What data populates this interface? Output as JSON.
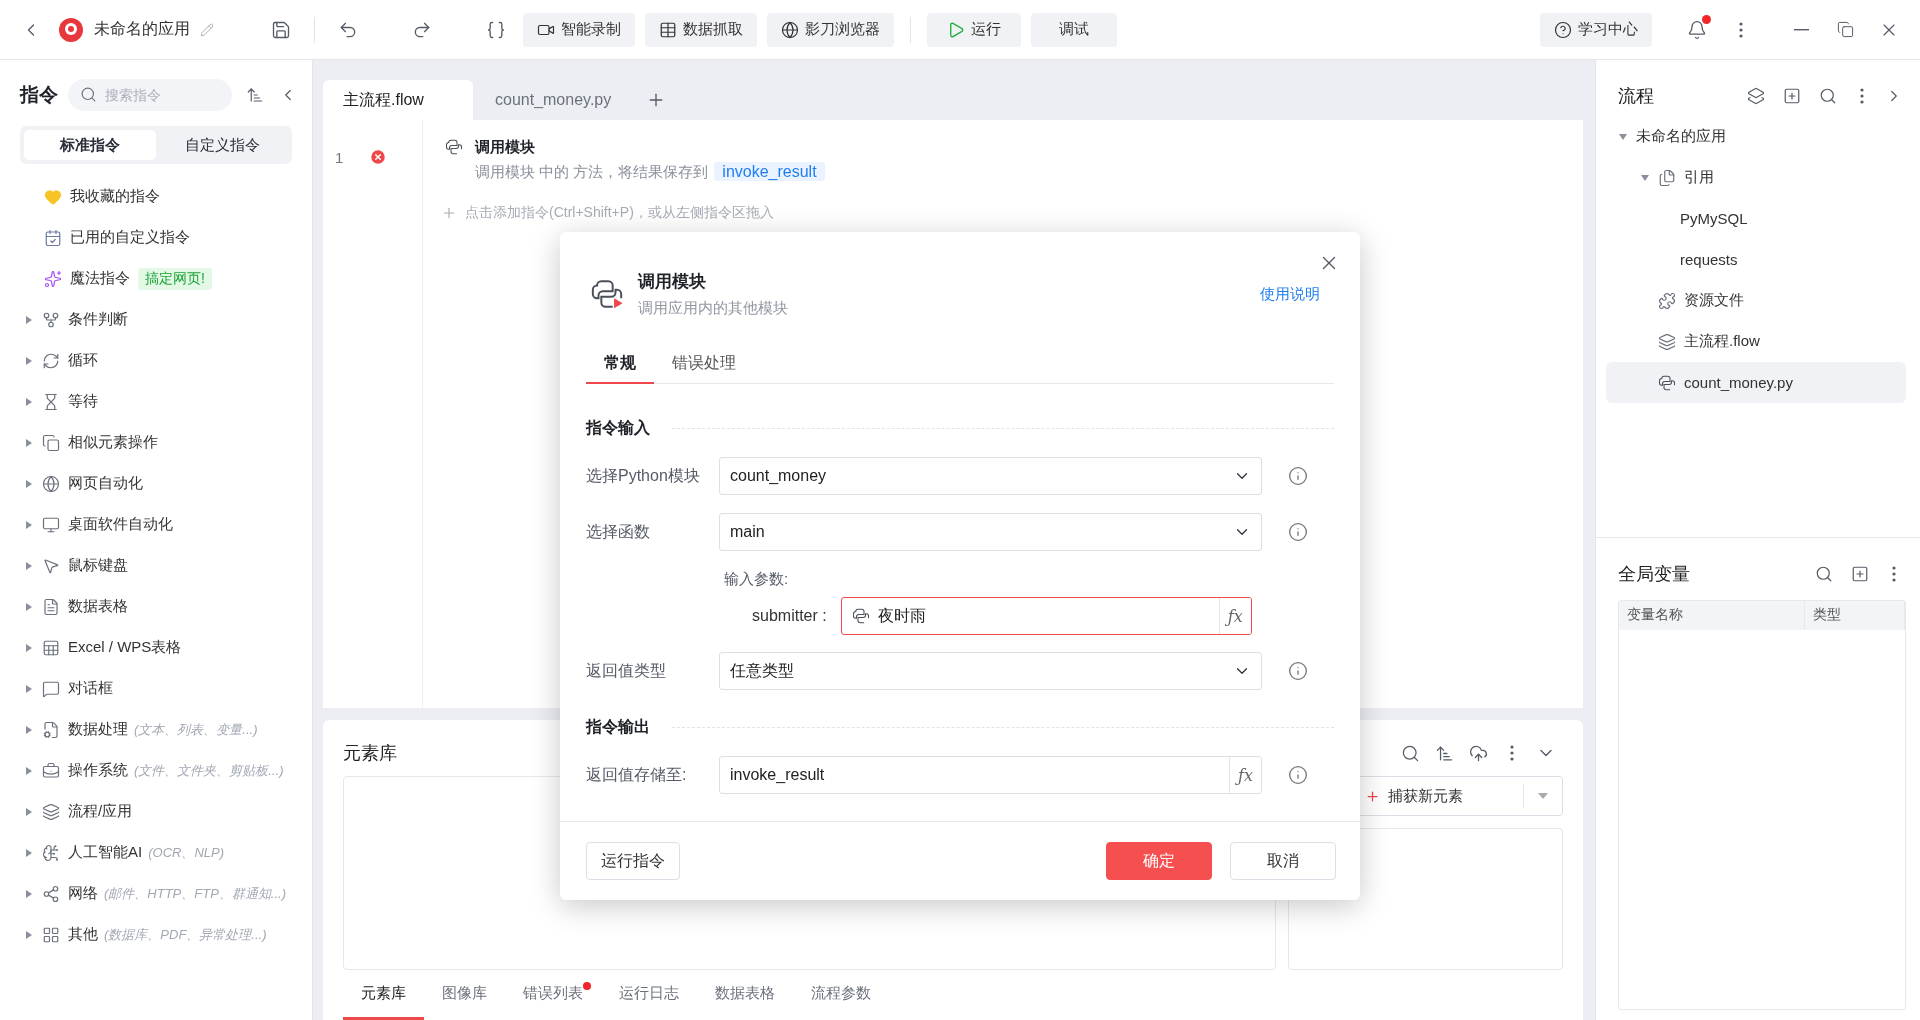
{
  "topbar": {
    "app_title": "未命名的应用",
    "tools": [
      {
        "label": "智能录制",
        "kind": "record"
      },
      {
        "label": "数据抓取",
        "kind": "grab"
      },
      {
        "label": "影刀浏览器",
        "kind": "browser"
      }
    ],
    "run": "运行",
    "debug": "调试",
    "learn": "学习中心",
    "notification": true
  },
  "sidebar": {
    "title": "指令",
    "search": {
      "placeholder": "搜索指令"
    },
    "tabs": [
      {
        "label": "标准指令",
        "selected": true
      },
      {
        "label": "自定义指令",
        "selected": false
      }
    ],
    "shortcuts": [
      {
        "label": "我收藏的指令",
        "kind": "favorite"
      },
      {
        "label": "已用的自定义指令",
        "kind": "custom"
      },
      {
        "label": "魔法指令",
        "kind": "magic",
        "badge": "搞定网页!"
      }
    ],
    "categories": [
      {
        "label": "条件判断",
        "expanded": false
      },
      {
        "label": "循环",
        "expanded": false
      },
      {
        "label": "等待",
        "expanded": false
      },
      {
        "label": "相似元素操作",
        "expanded": false
      },
      {
        "label": "网页自动化",
        "expanded": false
      },
      {
        "label": "桌面软件自动化",
        "expanded": false
      },
      {
        "label": "鼠标键盘",
        "expanded": false
      },
      {
        "label": "数据表格",
        "expanded": false
      },
      {
        "label": "Excel / WPS表格",
        "expanded": false
      },
      {
        "label": "对话框",
        "expanded": false
      },
      {
        "label": "数据处理",
        "hint": "(文本、列表、变量...)",
        "expanded": false
      },
      {
        "label": "操作系统",
        "hint": "(文件、文件夹、剪贴板...)",
        "expanded": false
      },
      {
        "label": "流程/应用",
        "expanded": false
      },
      {
        "label": "人工智能AI",
        "hint": "(OCR、NLP)",
        "expanded": false
      },
      {
        "label": "网络",
        "hint": "(邮件、HTTP、FTP、群通知...)",
        "expanded": false
      },
      {
        "label": "其他",
        "hint": "(数据库、PDF、异常处理...)",
        "expanded": false
      }
    ]
  },
  "editor": {
    "tabs": [
      {
        "label": "主流程.flow",
        "selected": true
      },
      {
        "label": "count_money.py",
        "selected": false
      }
    ],
    "lines": [
      {
        "number": "1",
        "error": true,
        "title": "调用模块",
        "description": "调用模块 中的 方法，将结果保存到",
        "variable": "invoke_result"
      }
    ],
    "add_hint": "点击添加指令(Ctrl+Shift+P)，或从左侧指令区拖入"
  },
  "element_panel": {
    "title": "元素库",
    "capture_button": "捕获新元素",
    "tabs": [
      {
        "label": "元素库",
        "selected": true,
        "alert": false
      },
      {
        "label": "图像库",
        "selected": false,
        "alert": false
      },
      {
        "label": "错误列表",
        "selected": false,
        "alert": true
      },
      {
        "label": "运行日志",
        "selected": false,
        "alert": false
      },
      {
        "label": "数据表格",
        "selected": false,
        "alert": false
      },
      {
        "label": "流程参数",
        "selected": false,
        "alert": false
      }
    ]
  },
  "dialog": {
    "title": "调用模块",
    "subtitle": "调用应用内的其他模块",
    "help_link": "使用说明",
    "tabs": [
      {
        "label": "常规",
        "selected": true
      },
      {
        "label": "错误处理",
        "selected": false
      }
    ],
    "sections": [
      {
        "title": "指令输入",
        "fields": [
          {
            "kind": "select",
            "label": "选择Python模块",
            "value": "count_money"
          },
          {
            "kind": "select",
            "label": "选择函数",
            "value": "main"
          },
          {
            "kind": "params",
            "label": "输入参数:",
            "params": [
              {
                "name": "submitter :",
                "value": "夜时雨",
                "error": true,
                "fx": "ƒx"
              }
            ]
          },
          {
            "kind": "select",
            "label": "返回值类型",
            "value": "任意类型"
          }
        ]
      },
      {
        "title": "指令输出",
        "fields": [
          {
            "kind": "input",
            "label": "返回值存储至:",
            "value": "invoke_result",
            "fx": "ƒx"
          }
        ]
      }
    ],
    "buttons": [
      {
        "label": "运行指令",
        "kind": "run"
      },
      {
        "label": "确定",
        "kind": "primary"
      },
      {
        "label": "取消",
        "kind": "default"
      }
    ]
  },
  "flow_panel": {
    "title": "流程",
    "tree": [
      {
        "label": "未命名的应用",
        "expanded": true,
        "selected": false,
        "children": [
          {
            "label": "引用",
            "kind": "references",
            "expanded": true,
            "selected": false,
            "children": [
              {
                "label": "PyMySQL",
                "selected": false
              },
              {
                "label": "requests",
                "selected": false
              }
            ]
          },
          {
            "label": "资源文件",
            "kind": "resources",
            "selected": false
          },
          {
            "label": "主流程.flow",
            "kind": "flow",
            "selected": false
          },
          {
            "label": "count_money.py",
            "kind": "python",
            "selected": true
          }
        ]
      }
    ]
  },
  "variables": {
    "title": "全局变量",
    "columns": [
      "变量名称",
      "类型"
    ]
  }
}
